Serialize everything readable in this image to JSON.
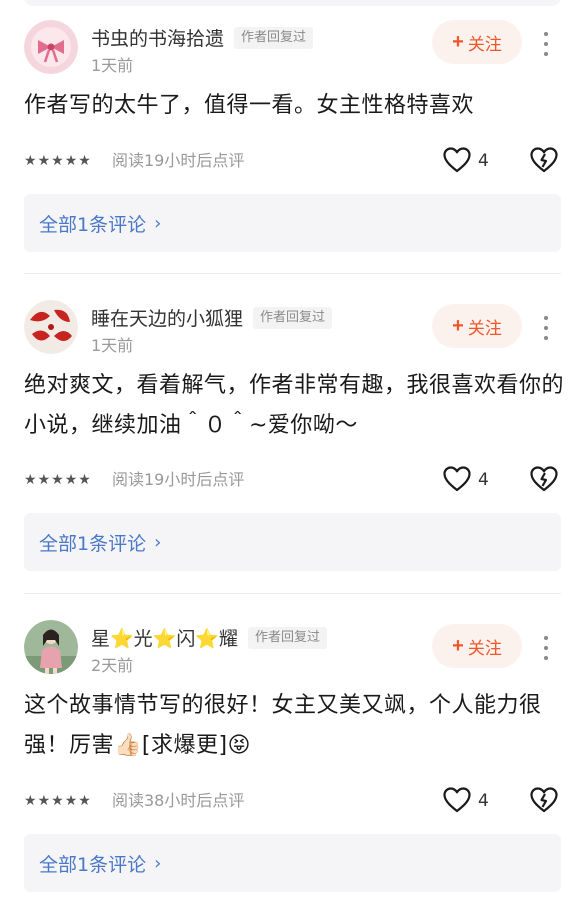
{
  "comments": [
    {
      "username": "书虫的书海拾遗",
      "badge": "作者回复过",
      "time": "1天前",
      "follow_label": "关注",
      "content": "作者写的太牛了，值得一看。女主性格特喜欢",
      "rating": 5,
      "read_note": "阅读19小时后点评",
      "likes": "4",
      "all_comments_label": "全部1条评论"
    },
    {
      "username": "睡在天边的小狐狸",
      "badge": "作者回复过",
      "time": "1天前",
      "follow_label": "关注",
      "content": "绝对爽文，看着解气，作者非常有趣，我很喜欢看你的小说，继续加油＾０＾~爱你呦～",
      "rating": 5,
      "read_note": "阅读19小时后点评",
      "likes": "4",
      "all_comments_label": "全部1条评论"
    },
    {
      "username": "星⭐光⭐闪⭐耀",
      "badge": "作者回复过",
      "time": "2天前",
      "follow_label": "关注",
      "content": "这个故事情节写的很好！女主又美又飒，个人能力很强！厉害👍🏻[求爆更]😝",
      "rating": 5,
      "read_note": "阅读38小时后点评",
      "likes": "4",
      "all_comments_label": "全部1条评论"
    }
  ],
  "icons": {
    "like": "heart-outline",
    "dislike": "broken-heart",
    "more": "vertical-ellipsis",
    "follow_plus": "plus"
  },
  "colors": {
    "accent": "#f0562c",
    "follow_bg": "#fbf2ee",
    "link": "#4a78c8",
    "muted": "#999999"
  }
}
